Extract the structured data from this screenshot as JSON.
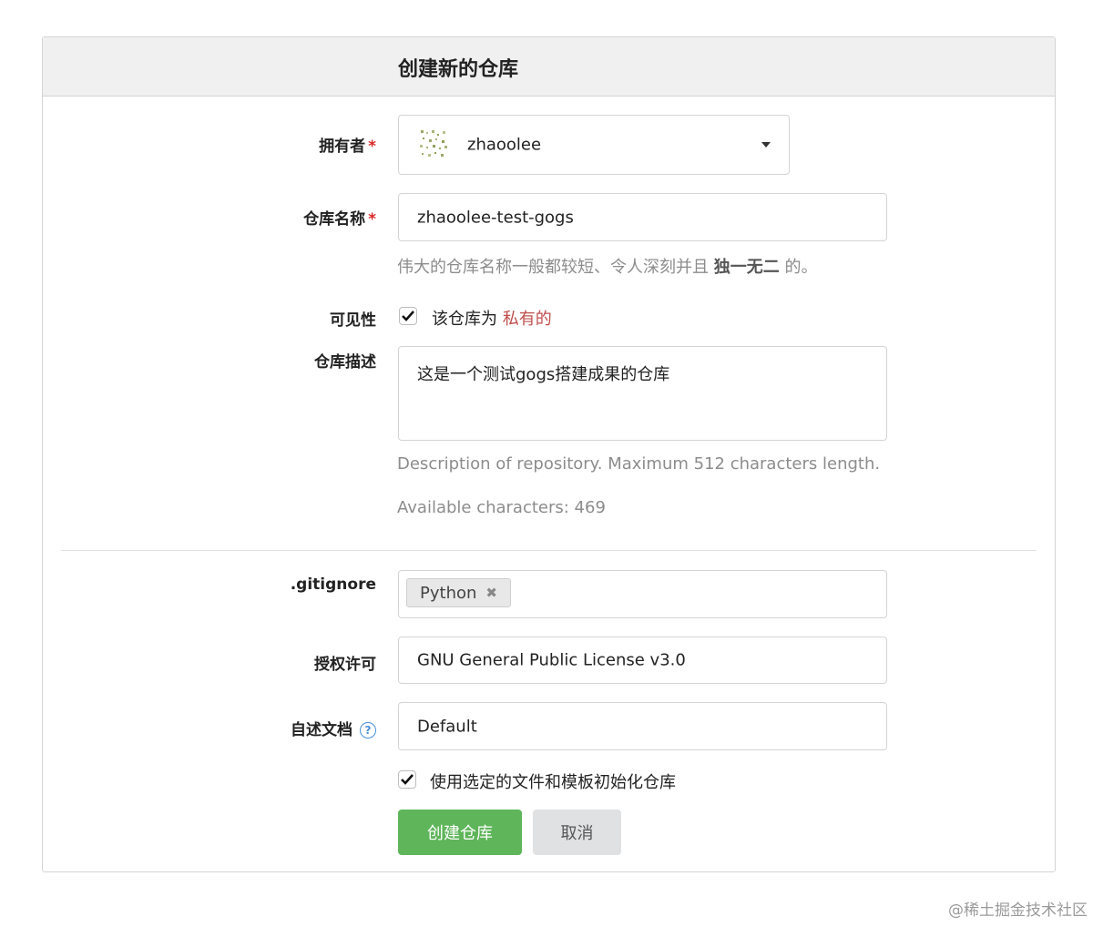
{
  "header": {
    "title": "创建新的仓库"
  },
  "form": {
    "owner": {
      "label": "拥有者",
      "required_mark": "*",
      "value": "zhaoolee"
    },
    "repo_name": {
      "label": "仓库名称",
      "required_mark": "*",
      "value": "zhaoolee-test-gogs",
      "help_prefix": "伟大的仓库名称一般都较短、令人深刻并且 ",
      "help_emphasis": "独一无二",
      "help_suffix": " 的。"
    },
    "visibility": {
      "label": "可见性",
      "checkbox_text": "该仓库为 ",
      "private_text": "私有的",
      "checked": true
    },
    "description": {
      "label": "仓库描述",
      "value": "这是一个测试gogs搭建成果的仓库",
      "help": "Description of repository. Maximum 512 characters length.",
      "available": "Available characters: 469"
    },
    "gitignore": {
      "label": ".gitignore",
      "chips": [
        "Python"
      ]
    },
    "license": {
      "label": "授权许可",
      "value": "GNU General Public License v3.0"
    },
    "readme": {
      "label": "自述文档",
      "value": "Default",
      "help_icon": "question-circle-icon"
    },
    "init": {
      "text": "使用选定的文件和模板初始化仓库",
      "checked": true
    }
  },
  "buttons": {
    "create": "创建仓库",
    "cancel": "取消"
  },
  "watermark": "@稀土掘金技术社区",
  "colors": {
    "primary": "#5fb55a",
    "required": "#db2828",
    "private": "#c0504d"
  }
}
